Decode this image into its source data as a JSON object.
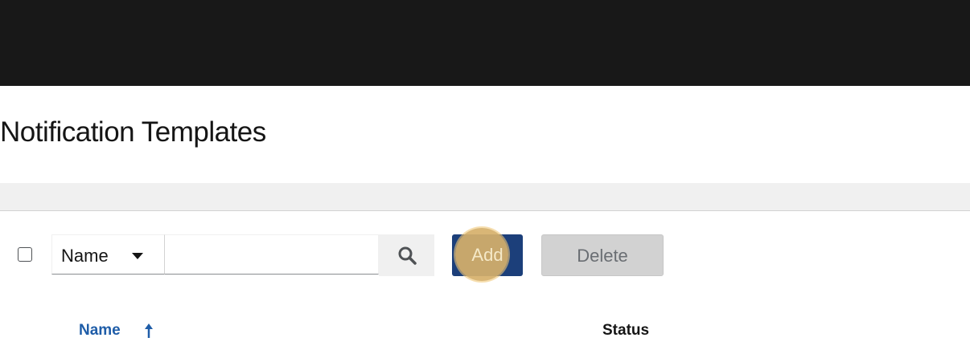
{
  "page": {
    "title": "Notification Templates"
  },
  "toolbar": {
    "filter_field": "Name",
    "search_value": "",
    "search_placeholder": "",
    "add_label": "Add",
    "delete_label": "Delete"
  },
  "table": {
    "columns": [
      "Name",
      "Status"
    ],
    "sort_column": "Name",
    "sort_direction": "ascending"
  },
  "colors": {
    "topbar": "#181818",
    "primary": "#1c3f7a",
    "link": "#1f5da8",
    "disabled": "#d2d2d2",
    "highlight": "#d6b06a"
  },
  "icons": {
    "search": "search-icon",
    "caret": "caret-down-icon",
    "sort": "sort-ascending-icon"
  }
}
